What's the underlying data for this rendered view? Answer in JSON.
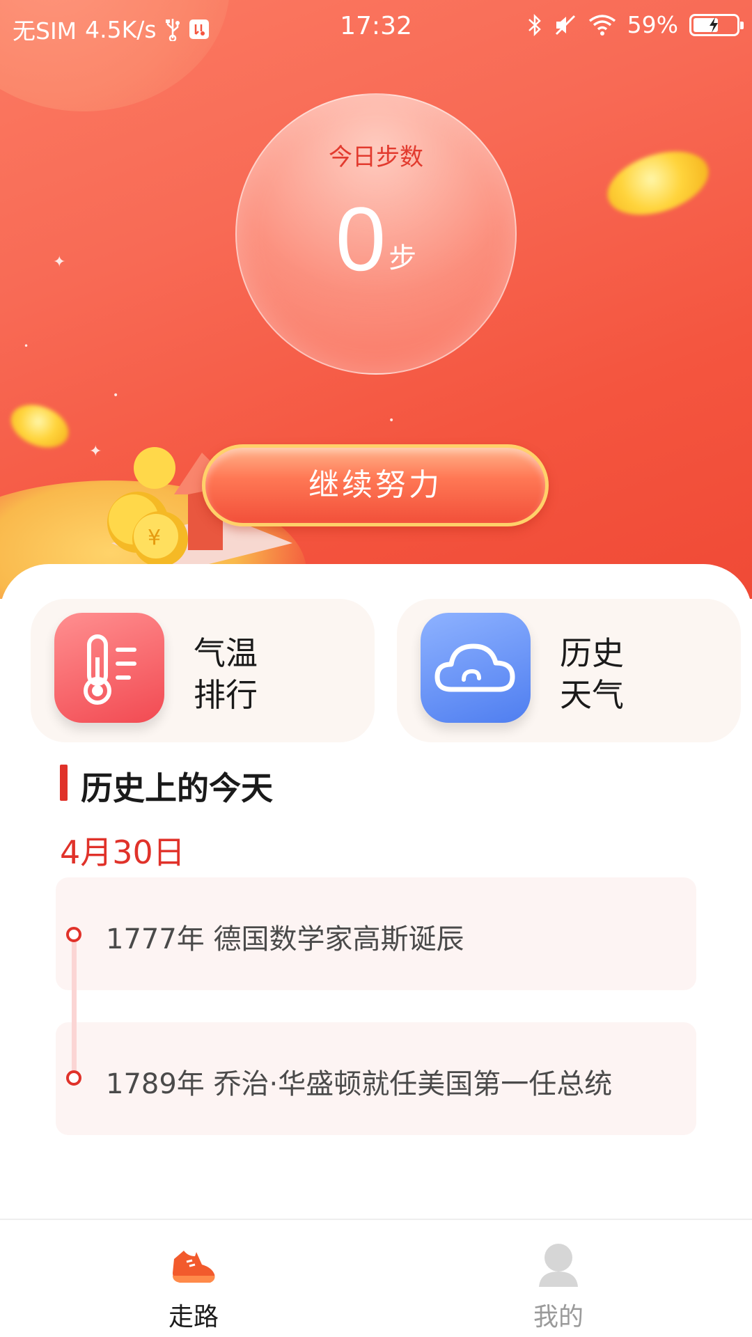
{
  "status_bar": {
    "carrier": "无SIM",
    "speed": "4.5K/s",
    "time": "17:32",
    "battery": "59%",
    "battery_level": 0.59,
    "icons": [
      "usb-icon",
      "usb-debug-icon",
      "bluetooth-icon",
      "mute-icon",
      "wifi-icon",
      "battery-icon"
    ]
  },
  "steps": {
    "label": "今日步数",
    "count": "0",
    "unit": "步"
  },
  "cta": {
    "label": "继续努力"
  },
  "tiles": [
    {
      "icon": "thermometer-icon",
      "line1": "气温",
      "line2": "排行"
    },
    {
      "icon": "cloud-icon",
      "line1": "历史",
      "line2": "天气"
    }
  ],
  "history": {
    "title": "历史上的今天",
    "date": "4月30日",
    "events": [
      "1777年 德国数学家高斯诞辰",
      "1789年 乔治·华盛顿就任美国第一任总统"
    ]
  },
  "bottom_nav": {
    "items": [
      {
        "label": "走路",
        "icon": "sneaker-icon",
        "active": true
      },
      {
        "label": "我的",
        "icon": "user-icon",
        "active": false
      }
    ]
  },
  "colors": {
    "accent_red": "#e0322a",
    "hero_gradient_start": "#fb7a62",
    "hero_gradient_end": "#f04a36",
    "temp_tile_icon": "#f24a52",
    "history_tile_icon": "#4f7ef0"
  }
}
